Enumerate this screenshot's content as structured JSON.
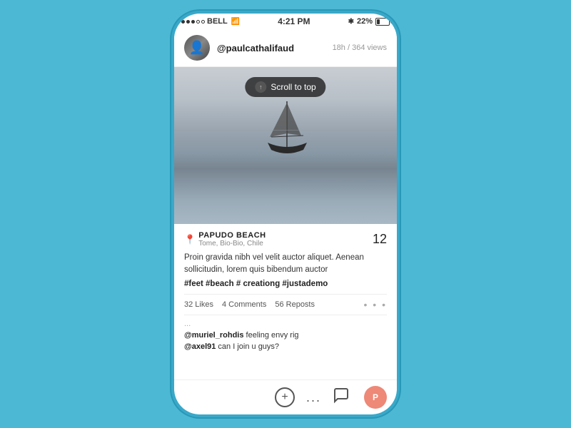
{
  "statusBar": {
    "carrier": "BELL",
    "time": "4:21 PM",
    "battery_pct": "22%"
  },
  "header": {
    "username": "@paulcathalifaud",
    "meta": "18h / 364 views"
  },
  "scrollToTop": {
    "label": "Scroll to top"
  },
  "post": {
    "location_name": "PAPUDO BEACH",
    "location_sub": "Tome, Bio-Bio, Chile",
    "like_count": "12",
    "caption": "Proin gravida nibh vel velit auctor aliquet. Aenean sollicitudin, lorem quis bibendum auctor",
    "tags": "#feet #beach # creationg #justademo",
    "likes": "32 Likes",
    "comments_count": "4 Comments",
    "reposts": "56 Reposts"
  },
  "comments": {
    "ellipsis": "...",
    "comment1_user": "@muriel_rohdis",
    "comment1_text": " feeling envy rig",
    "comment2_user": "@axel91",
    "comment2_text": " can I join u guys?"
  },
  "actions": {
    "plus": "+",
    "dots": "...",
    "chat": "💬"
  }
}
